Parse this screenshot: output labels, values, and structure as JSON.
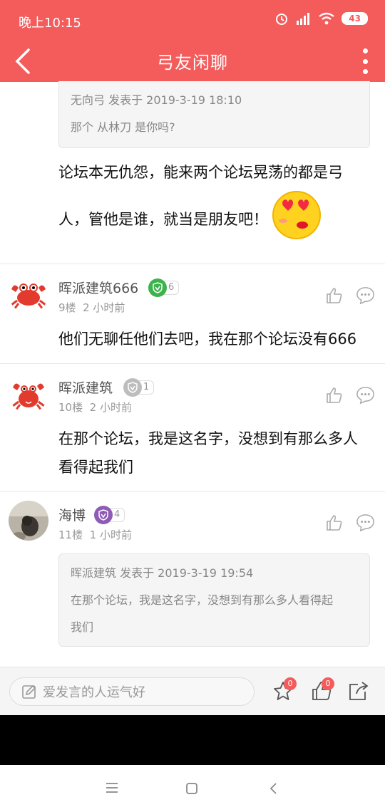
{
  "status_bar": {
    "time": "晚上10:15",
    "battery": "43"
  },
  "header": {
    "title": "弓友闲聊"
  },
  "top_quote": {
    "author_line": "无向弓 发表于 2019-3-19 18:10",
    "text": "那个 从林刀 是你吗?"
  },
  "top_post": {
    "line1": "论坛本无仇怨，能来两个论坛晃荡的都是弓",
    "line2": "人，管他是谁，就当是朋友吧！"
  },
  "posts": [
    {
      "username": "晖派建筑666",
      "level": "6",
      "badge_color": "#3bb34a",
      "floor": "9楼",
      "time": "2 小时前",
      "lines": [
        "他们无聊任他们去吧，我在那个论坛没有666"
      ]
    },
    {
      "username": "晖派建筑",
      "level": "1",
      "badge_color": "#bdbdbd",
      "floor": "10楼",
      "time": "2 小时前",
      "lines": [
        "在那个论坛，我是这名字，没想到有那么多人",
        "看得起我们"
      ]
    },
    {
      "username": "海博",
      "level": "4",
      "badge_color": "#8e5bb5",
      "floor": "11楼",
      "time": "1 小时前",
      "lines": []
    }
  ],
  "bottom_quote": {
    "author_line": "晖派建筑 发表于 2019-3-19 19:54",
    "line1": "在那个论坛，我是这名字，没想到有那么多人看得起",
    "line2": "我们"
  },
  "bottom_bar": {
    "placeholder": "爱发言的人运气好",
    "favorite_count": "0",
    "like_count": "0"
  },
  "accent_color": "#f45b5b"
}
